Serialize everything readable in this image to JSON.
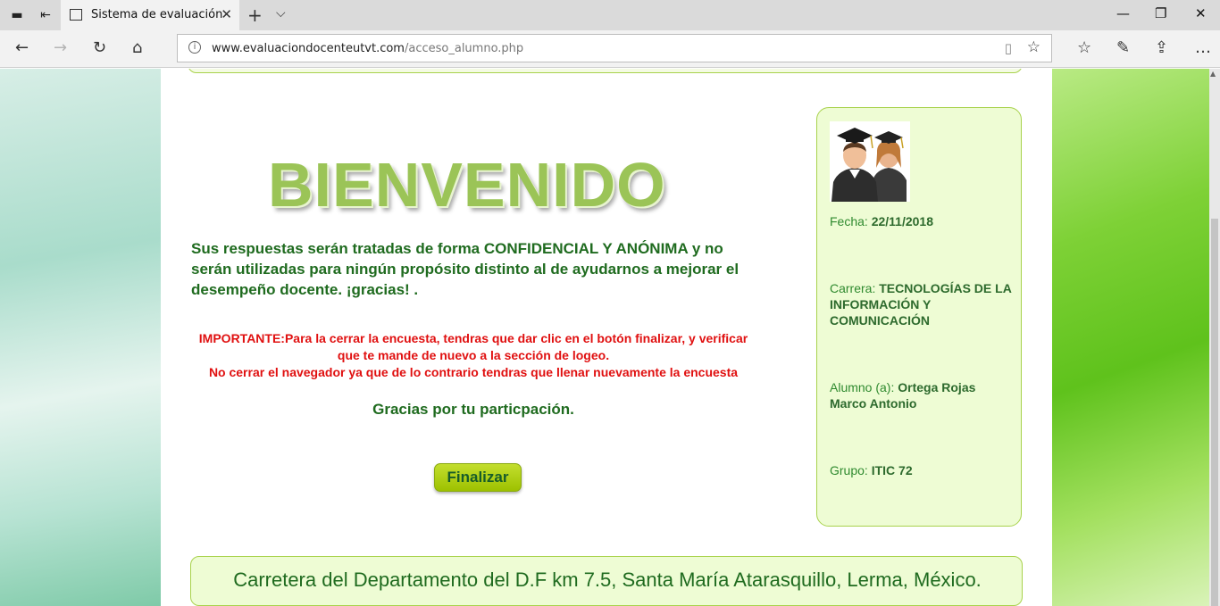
{
  "browser": {
    "tab_title": "Sistema de evaluación",
    "url_host": "www.evaluaciondocenteutvt.com",
    "url_path": "/acceso_alumno.php",
    "icons": {
      "tab_actions": "tab-preview-icon",
      "set_aside": "set-aside-tabs-icon",
      "back": "back-arrow-icon",
      "forward": "forward-arrow-icon",
      "refresh": "refresh-icon",
      "home": "home-icon",
      "info": "info-icon",
      "reading_view": "reading-view-icon",
      "favorite": "star-icon",
      "favorites_hub": "favorites-hub-icon",
      "notes": "pen-icon",
      "share": "share-icon",
      "more": "more-icon"
    }
  },
  "page": {
    "welcome": "BIENVENIDO",
    "intro_text": "Sus respuestas serán tratadas de forma CONFIDENCIAL Y ANÓNIMA y no serán utilizadas para ningún propósito distinto al de ayudarnos a mejorar el desempeño docente. ¡gracias! .",
    "important_line1": "IMPORTANTE:Para la cerrar la encuesta, tendras que dar clic en el botón finalizar, y verificar que te mande de nuevo a la sección de logeo.",
    "important_line2": "No cerrar el navegador ya que de lo contrario tendras que llenar nuevamente la encuesta",
    "thanks": "Gracias por tu particpación.",
    "finish_button": "Finalizar"
  },
  "student_panel": {
    "avatar": "graduates-icon",
    "fecha_label": "Fecha:",
    "fecha": "22/11/2018",
    "carrera_label": "Carrera:",
    "carrera": "TECNOLOGÍAS DE LA INFORMACIÓN Y COMUNICACIÓN",
    "alumno_label": "Alumno (a):",
    "alumno": "Ortega Rojas Marco Antonio",
    "grupo_label": "Grupo:",
    "grupo": "ITIC 72"
  },
  "footer": {
    "address": "Carretera del Departamento del D.F km 7.5, Santa María Atarasquillo, Lerma, México."
  },
  "colors": {
    "title_green": "#9bc457",
    "text_green": "#1f6b1f",
    "important_red": "#e01010",
    "panel_bg": "#eefcd4",
    "panel_border": "#a8d24c",
    "button_green": "#a8cc10"
  }
}
